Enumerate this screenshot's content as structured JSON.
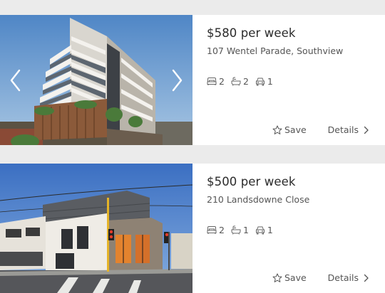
{
  "listings": [
    {
      "price": "$580 per week",
      "address": "107 Wentel Parade, Southview",
      "bedrooms": "2",
      "bathrooms": "2",
      "parking": "1",
      "save_label": "Save",
      "details_label": "Details"
    },
    {
      "price": "$500 per week",
      "address": "210 Landsdowne Close",
      "bedrooms": "2",
      "bathrooms": "1",
      "parking": "1",
      "save_label": "Save",
      "details_label": "Details"
    }
  ],
  "icons": {
    "bed": "bed-icon",
    "bath": "bath-icon",
    "car": "car-icon",
    "save": "star-icon",
    "details": "chevron-right-icon",
    "prev": "chevron-left-icon",
    "next": "chevron-right-icon"
  },
  "colors": {
    "page_background": "#ebebeb",
    "card_background": "#ffffff",
    "text_primary": "#2b2b2b",
    "text_secondary": "#555555"
  }
}
